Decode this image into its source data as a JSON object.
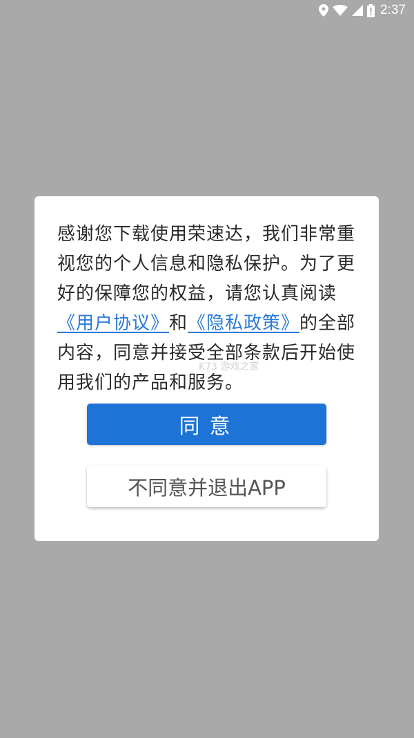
{
  "status_bar": {
    "time": "2:37",
    "icons": [
      "location-icon",
      "wifi-icon",
      "cell-signal-icon",
      "battery-icon"
    ]
  },
  "dialog": {
    "message_part1": "感谢您下载使用荣速达，我们非常重视您的个人信息和隐私保护。为了更好的保障您的权益，请您认真阅读",
    "user_agreement_link": "《用户协议》",
    "conjunction": "和",
    "privacy_policy_link": "《隐私政策》",
    "message_part2": "的全部内容，同意并接受全部条款后开始使用我们的产品和服务。",
    "agree_label": "同意",
    "disagree_label": "不同意并退出APP",
    "watermark": "K73 游戏之家"
  },
  "colors": {
    "overlay": "#a9a9a9",
    "accent": "#1d73d6",
    "link": "#2a7bd6"
  }
}
